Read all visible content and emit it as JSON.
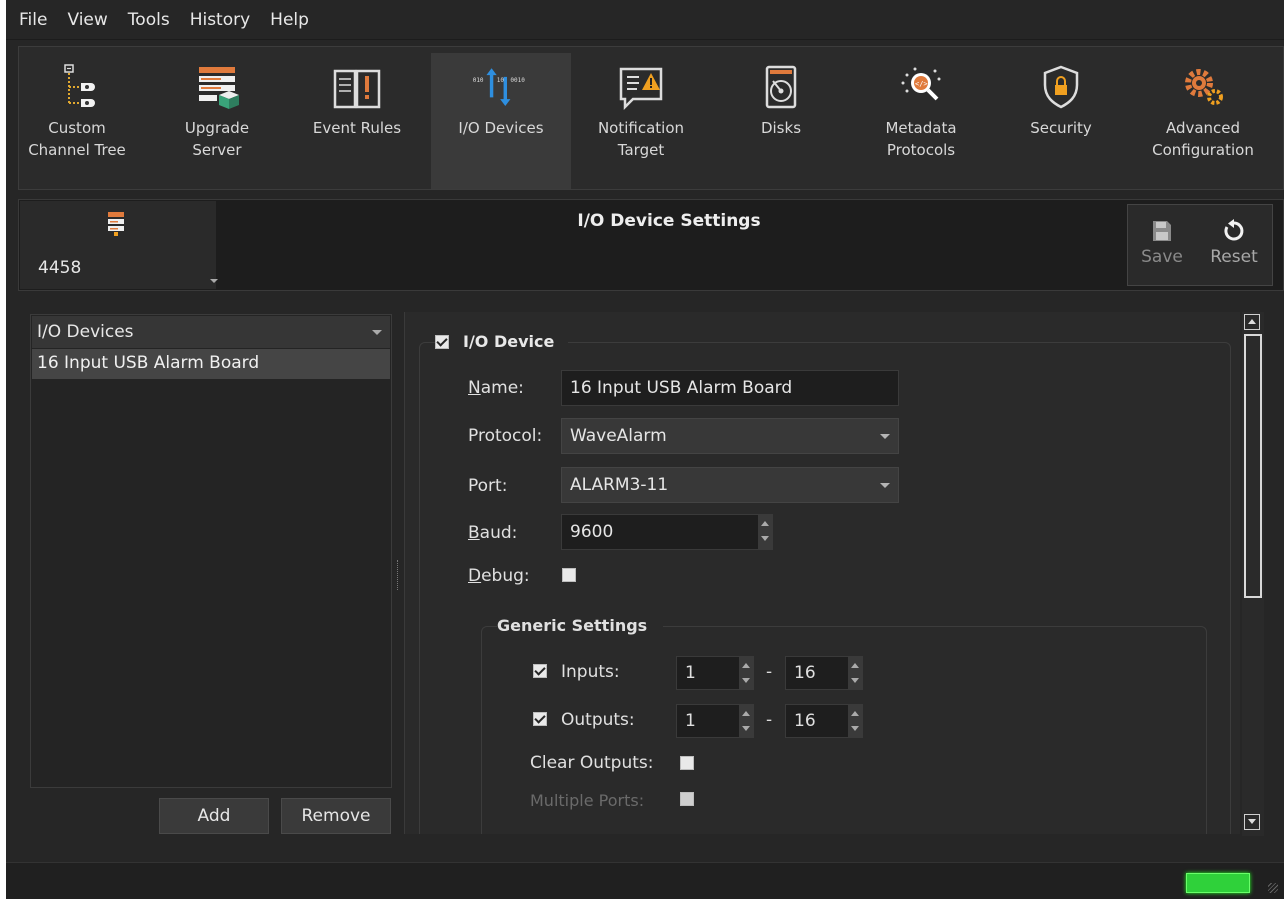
{
  "menu": {
    "items": [
      {
        "label": "File"
      },
      {
        "label": "View"
      },
      {
        "label": "Tools"
      },
      {
        "label": "History"
      },
      {
        "label": "Help"
      }
    ]
  },
  "toolbar": {
    "items": [
      {
        "label": "Custom\nChannel Tree",
        "icon": "channel-tree-icon"
      },
      {
        "label": "Upgrade\nServer",
        "icon": "upgrade-server-icon"
      },
      {
        "label": "Event Rules",
        "icon": "event-rules-icon"
      },
      {
        "label": "I/O Devices",
        "icon": "io-devices-icon"
      },
      {
        "label": "Notification\nTarget",
        "icon": "notification-target-icon"
      },
      {
        "label": "Disks",
        "icon": "disk-icon"
      },
      {
        "label": "Metadata\nProtocols",
        "icon": "metadata-icon"
      },
      {
        "label": "Security",
        "icon": "shield-lock-icon"
      },
      {
        "label": "Advanced\nConfiguration",
        "icon": "gears-icon"
      }
    ],
    "active": "I/O Devices",
    "io_icon_text_left": "010",
    "io_icon_text_mid": "10",
    "io_icon_text_right": "0010"
  },
  "header": {
    "site_id": "4458",
    "title": "I/O Device Settings",
    "save_label": "Save",
    "reset_label": "Reset"
  },
  "left": {
    "select_value": "I/O Devices",
    "list_items": [
      "16 Input USB Alarm Board"
    ],
    "add_label": "Add",
    "remove_label": "Remove"
  },
  "device": {
    "group_title": "I/O Device",
    "enabled": true,
    "name_label": "Name:",
    "name_label_u": "N",
    "name_label_rest": "ame:",
    "name_value": "16 Input USB Alarm Board",
    "protocol_label": "Protocol:",
    "protocol_value": "WaveAlarm",
    "port_label": "Port:",
    "port_value": "ALARM3-11",
    "baud_label": "Baud:",
    "baud_label_u": "B",
    "baud_label_rest": "aud:",
    "baud_value": "9600",
    "debug_label": "Debug:",
    "debug_label_u": "D",
    "debug_label_rest": "ebug:"
  },
  "generic": {
    "title": "Generic Settings",
    "inputs_label": "Inputs:",
    "inputs_from": "1",
    "inputs_to": "16",
    "outputs_label": "Outputs:",
    "outputs_from": "1",
    "outputs_to": "16",
    "dash": "-",
    "clear_outputs_label": "Clear Outputs:",
    "multiple_ports_label": "Multiple Ports:"
  },
  "colors": {
    "background": "#262626",
    "status_ok": "#2fd13a"
  }
}
